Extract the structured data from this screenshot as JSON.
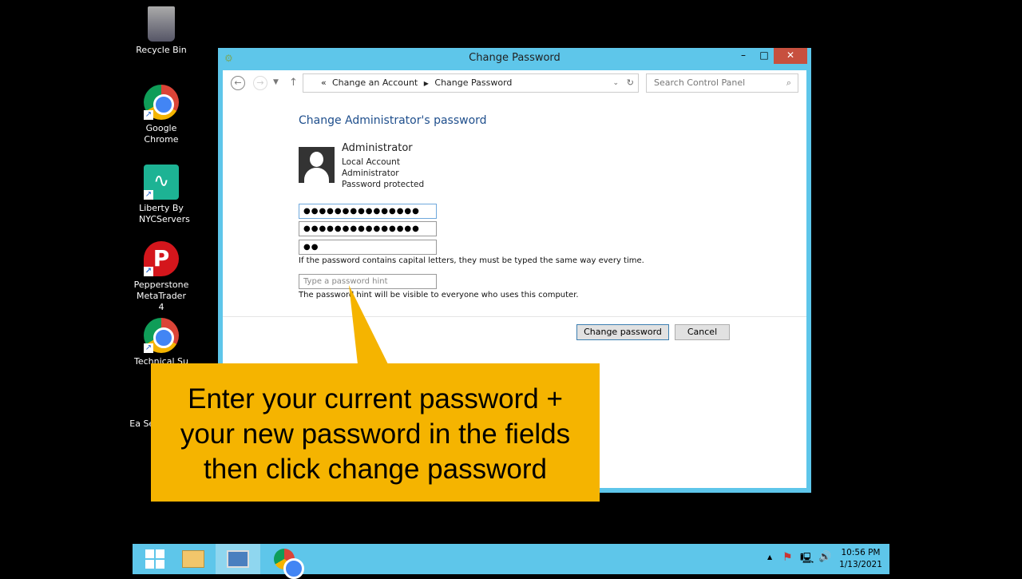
{
  "desktop": {
    "icons": [
      {
        "label": "Recycle Bin"
      },
      {
        "label": "Google Chrome"
      },
      {
        "label": "Liberty By NYCServers"
      },
      {
        "label": "Pepperstone MetaTrader 4"
      },
      {
        "label": "Technical Su"
      },
      {
        "label": "Ea Ser"
      }
    ]
  },
  "window": {
    "title": "Change Password",
    "minimize": "–",
    "maximize": "□",
    "close": "✕"
  },
  "address": {
    "chevrons": "«",
    "crumbs": [
      "Change an Account",
      "Change Password"
    ],
    "search_placeholder": "Search Control Panel"
  },
  "main": {
    "heading": "Change Administrator's password",
    "user_name": "Administrator",
    "user_lines": [
      "Local Account",
      "Administrator",
      "Password protected"
    ],
    "current_password": "●●●●●●●●●●●●●●●",
    "new_password": "●●●●●●●●●●●●●●●",
    "confirm_password": "●●",
    "caps_note": "If the password contains capital letters, they must be typed the same way every time.",
    "hint_placeholder": "Type a password hint",
    "hint_note": "The password hint will be visible to everyone who uses this computer.",
    "change_button": "Change password",
    "cancel_button": "Cancel"
  },
  "callout": {
    "lines": [
      "Enter your current password +",
      "your new password in the fields",
      "then click change password"
    ],
    "color": "#f5b400"
  },
  "taskbar": {
    "time": "10:56 PM",
    "date": "1/13/2021"
  }
}
